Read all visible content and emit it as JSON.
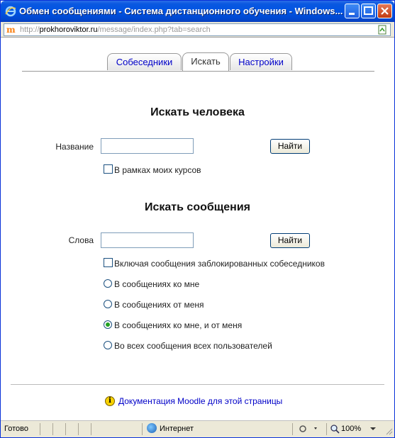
{
  "window": {
    "title": "Обмен сообщениями - Система дистанционного обучения - Windows..."
  },
  "address": {
    "url_prefix": "http://",
    "host": "prokhoroviktor.ru",
    "path": "/message/index.php?tab=search"
  },
  "tabs": [
    {
      "label": "Собеседники",
      "active": false
    },
    {
      "label": "Искать",
      "active": true
    },
    {
      "label": "Настройки",
      "active": false
    }
  ],
  "search_person": {
    "heading": "Искать человека",
    "name_label": "Название",
    "name_value": "",
    "find_button": "Найти",
    "my_courses_label": "В рамках моих курсов",
    "my_courses_checked": false
  },
  "search_messages": {
    "heading": "Искать сообщения",
    "words_label": "Слова",
    "words_value": "",
    "find_button": "Найти",
    "include_blocked_label": "Включая сообщения заблокированных собеседников",
    "include_blocked_checked": false,
    "scope_options": [
      {
        "label": "В сообщениях ко мне",
        "checked": false
      },
      {
        "label": "В сообщениях от меня",
        "checked": false
      },
      {
        "label": "В сообщениях ко мне, и от меня",
        "checked": true
      },
      {
        "label": "Во всех сообщения всех пользователей",
        "checked": false
      }
    ]
  },
  "footer": {
    "docs_link": "Документация Moodle для этой страницы"
  },
  "statusbar": {
    "status": "Готово",
    "zone": "Интернет",
    "zoom": "100%"
  },
  "colors": {
    "titlebar": "#0054e3",
    "link": "#0000c8",
    "radio_selected": "#21a121"
  }
}
